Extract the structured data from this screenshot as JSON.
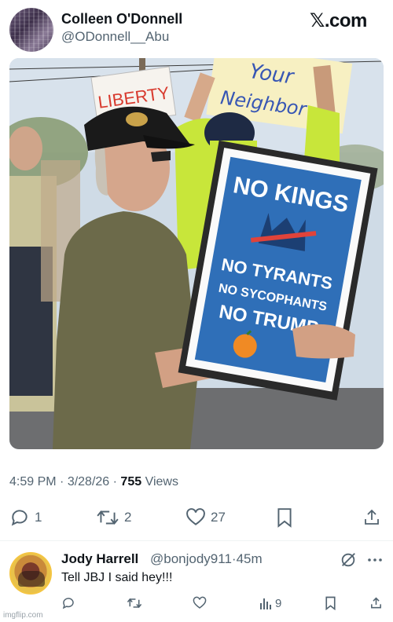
{
  "site": {
    "logo": "𝕏.com",
    "watermark": "imgflip.com"
  },
  "post": {
    "author_name": "Colleen O'Donnell",
    "author_handle": "@ODonnell__Abu",
    "photo": {
      "sign_liberty": "LIBERTY",
      "sign_your": "Your",
      "sign_neighbor": "Neighbor",
      "sign_line1": "NO KINGS",
      "sign_line2": "NO TYRANTS",
      "sign_line3": "NO SYCOPHANTS",
      "sign_line4": "NO TRUMP"
    },
    "time": "4:59 PM",
    "sep1": " · ",
    "date": "3/28/26",
    "sep2": " · ",
    "views_count": "755",
    "views_label": " Views",
    "actions": {
      "replies": "1",
      "reposts": "2",
      "likes": "27"
    }
  },
  "reply": {
    "author_name": "Jody Harrell",
    "author_handle": "@bonjody911",
    "time_sep": "·",
    "time": "45m",
    "text": "Tell JBJ I said hey!!!",
    "actions": {
      "views": "9"
    }
  },
  "icons": [
    "reply-icon",
    "repost-icon",
    "like-icon",
    "bookmark-icon",
    "share-icon",
    "grok-icon",
    "more-icon",
    "views-icon"
  ],
  "colors": {
    "text": "#0f1419",
    "muted": "#536471",
    "sign_blue": "#2f6fb8",
    "vest_yellow": "#c8e63a"
  }
}
